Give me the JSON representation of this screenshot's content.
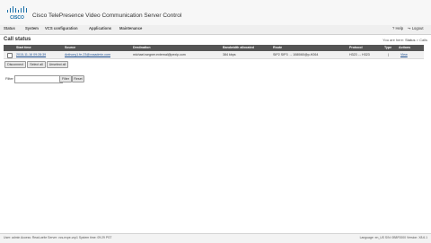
{
  "header": {
    "logo_text": "CISCO",
    "title": "Cisco TelePresence Video Communication Server Control"
  },
  "menu": {
    "items": [
      "Status",
      "System",
      "VCS configuration",
      "Applications",
      "Maintenance"
    ],
    "help": "Help",
    "logout": "Logout"
  },
  "page": {
    "title": "Call status",
    "breadcrumb": {
      "prefix": "You are here:",
      "status": "Status",
      "separator": ">",
      "current": "Calls"
    }
  },
  "table": {
    "headers": [
      "Start time",
      "Source",
      "Destination",
      "Bandwidth allocated",
      "Route",
      "Protocol",
      "Type",
      "Actions"
    ],
    "rows": [
      {
        "start_time": "2015-11-16 09:28:39",
        "source": "Anthony1.fe-23@vcsadmin.com",
        "destination": "michael.wegner.external@pexip.com",
        "bandwidth": "384 kbps",
        "route": "SIP2 SIP3 → 1080i60@p-H264",
        "protocol": "H323 ↔ H323",
        "type": "|",
        "action": "View"
      }
    ]
  },
  "buttons": {
    "disconnect": "Disconnect",
    "select_all": "Select all",
    "unselect_all": "Unselect all",
    "filter": "Filter",
    "reset": "Reset"
  },
  "filter": {
    "label": "Filter",
    "value": ""
  },
  "footer": {
    "left": "User: admin  Access: Read-write  Server: vcs-expe-vcp1  System time: 09:29 PST",
    "right": "Language: en_US  S/N: 0B8F0000  Version: X8.6.1"
  },
  "colors": {
    "table_header": "#555555",
    "link": "#1a4d8f",
    "logo": "#1a6fa8"
  }
}
